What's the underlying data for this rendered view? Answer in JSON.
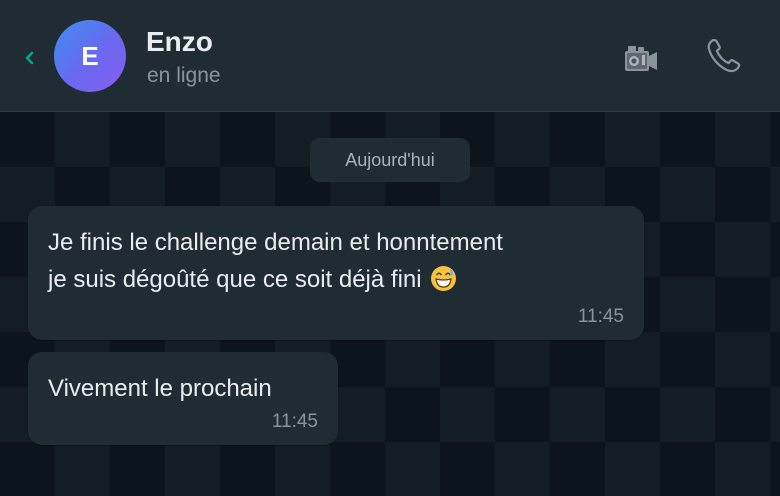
{
  "header": {
    "avatar_initial": "E",
    "contact_name": "Enzo",
    "status": "en ligne",
    "back_icon": "chevron-left-icon",
    "video_icon": "video-camera-icon",
    "call_icon": "phone-icon"
  },
  "chat": {
    "date_separator": "Aujourd'hui",
    "messages": [
      {
        "line1": "Je finis le challenge demain et honntement",
        "line2": "je suis dégoûté que ce soit déjà fini",
        "emoji": "grinning-sweat-emoji",
        "time": "11:45"
      },
      {
        "text": "Vivement le prochain",
        "time": "11:45"
      }
    ]
  },
  "colors": {
    "header_bg": "#1f2c34",
    "chat_bg": "#0b141a",
    "bubble_bg": "#202c33",
    "accent": "#00a884",
    "text_primary": "#e9edef",
    "text_secondary": "#8696a0"
  }
}
